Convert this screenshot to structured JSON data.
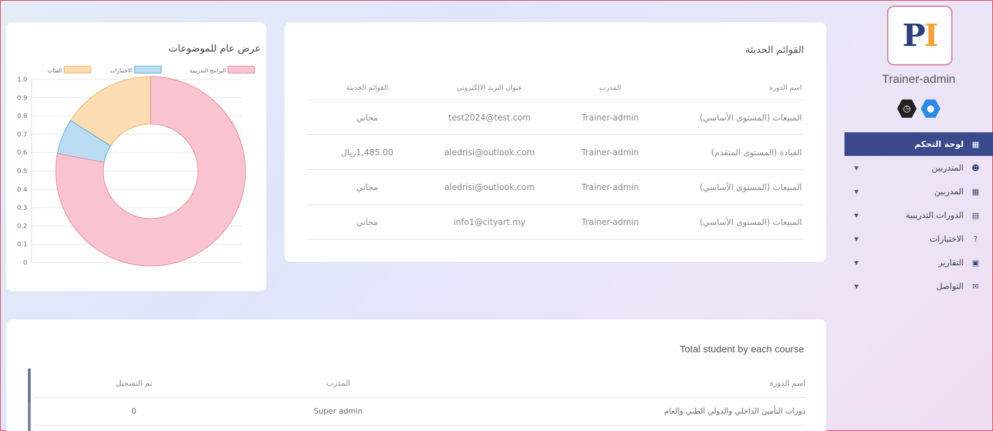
{
  "sidebar": {
    "username": "Trainer-admin",
    "logo_text_p": "P",
    "logo_text_i": "I",
    "menu": [
      {
        "label": "لوحة التحكم",
        "icon": "grid-icon",
        "active": true
      },
      {
        "label": "المتدربين",
        "icon": "user-icon"
      },
      {
        "label": "المدربين",
        "icon": "grid-icon"
      },
      {
        "label": "الدورات التدريبية",
        "icon": "book-icon"
      },
      {
        "label": "الاختبارات",
        "icon": "question-icon"
      },
      {
        "label": "التقارير",
        "icon": "chart-icon"
      },
      {
        "label": "التواصل",
        "icon": "chat-icon"
      }
    ]
  },
  "recent": {
    "title": "القوائم الحديثة",
    "headers": [
      "اسم الدورة",
      "المدرب",
      "عنوان البريد الالكتروني",
      "القوائم الحديثة"
    ],
    "rows": [
      [
        "المبيعات (المستوى الأساسي)",
        "Trainer-admin",
        "test2024@test.com",
        "مجاني"
      ],
      [
        "القيادة (المستوى المتقدم)",
        "Trainer-admin",
        "aledrisi@outlook.com",
        "1,485.00ريال"
      ],
      [
        "المبيعات (المستوى الأساسي)",
        "Trainer-admin",
        "aledrisi@outlook.com",
        "مجاني"
      ],
      [
        "المبيعات (المستوى الأساسي)",
        "Trainer-admin",
        "info1@cityart.my",
        "مجاني"
      ]
    ]
  },
  "chart_card": {
    "title": "عرض عام للموضوعات"
  },
  "chart_data": {
    "type": "pie",
    "variant": "doughnut",
    "legend_position": "top",
    "categories": [
      "البرامج التدريبية",
      "الاختبارات",
      "الفئات"
    ],
    "values": [
      0.78,
      0.06,
      0.16
    ],
    "colors": [
      "#f9c4cf",
      "#bcdcf2",
      "#fbdcb3"
    ],
    "stroke_colors": [
      "#e7899d",
      "#5aa8dd",
      "#f3ae60"
    ],
    "yticks": [
      "1.0",
      "0.9",
      "0.8",
      "0.7",
      "0.6",
      "0.5",
      "0.4",
      "0.3",
      "0.2",
      "0.1",
      "0"
    ],
    "grid": true
  },
  "bottom": {
    "title": "Total student by each course",
    "headers": [
      "اسم الدورة",
      "المدرب",
      "تم التسجيل"
    ],
    "rows": [
      [
        "دورات التأمين الداخلي والدولي الطبي والعام",
        "Super admin",
        "0"
      ]
    ]
  },
  "colors": {
    "sidebar_active": "#3a4a8d",
    "accent_blue": "#2d8ae6"
  }
}
